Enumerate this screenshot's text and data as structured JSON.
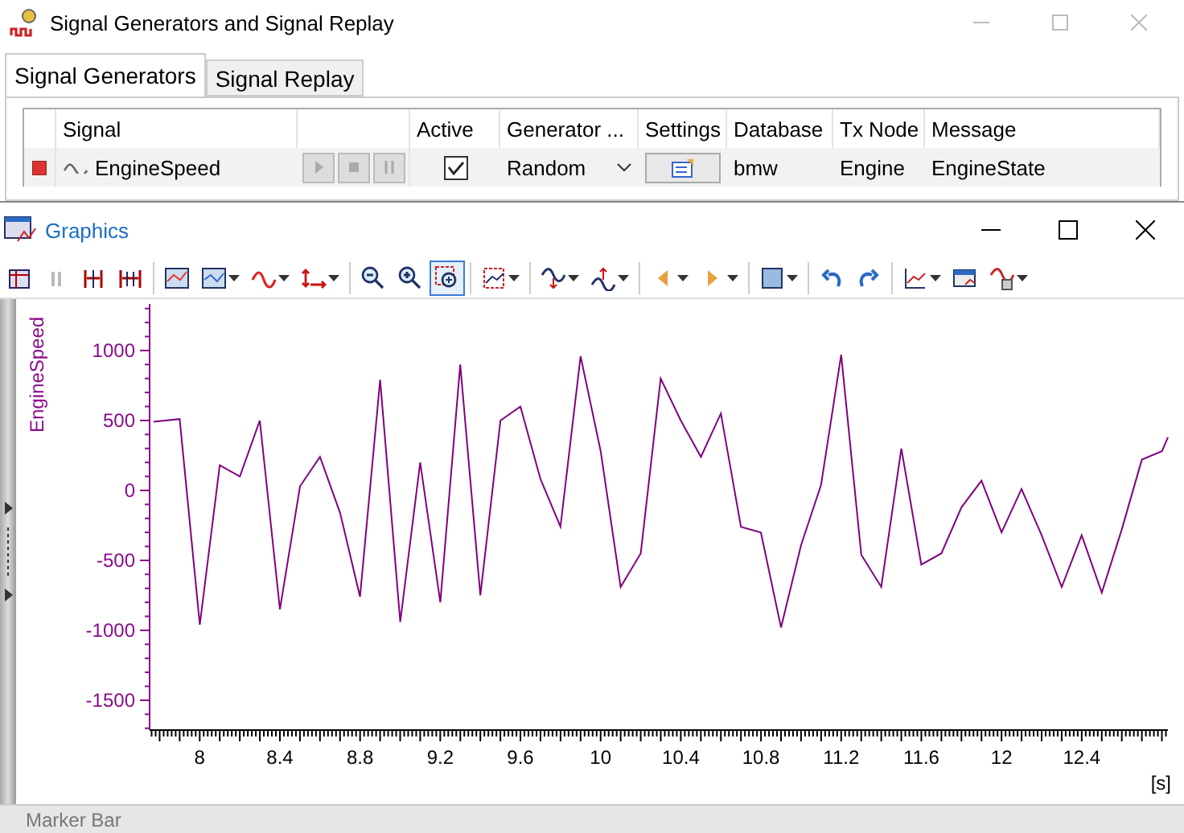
{
  "signal_window": {
    "title": "Signal Generators and Signal Replay",
    "tabs": [
      {
        "label": "Signal Generators",
        "selected": true
      },
      {
        "label": "Signal Replay",
        "selected": false
      }
    ],
    "table": {
      "columns": [
        "Signal",
        "Active",
        "Generator ...",
        "Settings",
        "Database",
        "Tx Node",
        "Message"
      ],
      "rows": [
        {
          "signal": "EngineSpeed",
          "player_enabled": false,
          "active": true,
          "generator": "Random",
          "database": "bmw",
          "tx_node": "Engine",
          "message": "EngineState"
        }
      ]
    }
  },
  "graphics_window": {
    "title": "Graphics",
    "chart_data": {
      "type": "line",
      "xlabel": "[s]",
      "ylabel": "EngineSpeed",
      "xlim": [
        7.75,
        12.83
      ],
      "ylim": [
        -1713,
        1333
      ],
      "xticks": [
        8,
        {
          "value": 8.4,
          "label": "8.4"
        },
        {
          "value": 8.8,
          "label": "8.8"
        },
        {
          "value": 9.2,
          "label": "9.2"
        },
        {
          "value": 9.6,
          "label": "9.6"
        },
        10,
        {
          "value": 10.4,
          "label": "10.4"
        },
        {
          "value": 10.8,
          "label": "10.8"
        },
        {
          "value": 11.2,
          "label": "11.2"
        },
        {
          "value": 11.6,
          "label": "11.6"
        },
        12,
        {
          "value": 12.4,
          "label": "12.4"
        }
      ],
      "yticks": [
        -1500,
        -1000,
        -500,
        0,
        500,
        1000
      ],
      "x": [
        7.77,
        7.9,
        8.0,
        8.1,
        8.2,
        8.3,
        8.4,
        8.5,
        8.6,
        8.7,
        8.8,
        8.9,
        9.0,
        9.1,
        9.2,
        9.3,
        9.4,
        9.5,
        9.6,
        9.7,
        9.8,
        9.9,
        10.0,
        10.1,
        10.2,
        10.3,
        10.4,
        10.5,
        10.6,
        10.7,
        10.8,
        10.9,
        11.0,
        11.1,
        11.2,
        11.3,
        11.4,
        11.5,
        11.6,
        11.7,
        11.8,
        11.9,
        12.0,
        12.1,
        12.2,
        12.3,
        12.4,
        12.5,
        12.6,
        12.7,
        12.8,
        12.83
      ],
      "series": [
        {
          "color": "#800080",
          "values": [
            490,
            510,
            -960,
            180,
            100,
            500,
            -850,
            30,
            240,
            -160,
            -760,
            790,
            -940,
            200,
            -800,
            900,
            -750,
            500,
            600,
            80,
            -260,
            960,
            280,
            -690,
            -450,
            800,
            500,
            240,
            550,
            -260,
            -300,
            -980,
            -390,
            40,
            970,
            -460,
            -690,
            300,
            -530,
            -450,
            -120,
            70,
            -300,
            10,
            -320,
            -690,
            -320,
            -730,
            -280,
            220,
            280,
            380
          ]
        }
      ]
    },
    "marker_bar": "Marker Bar"
  }
}
